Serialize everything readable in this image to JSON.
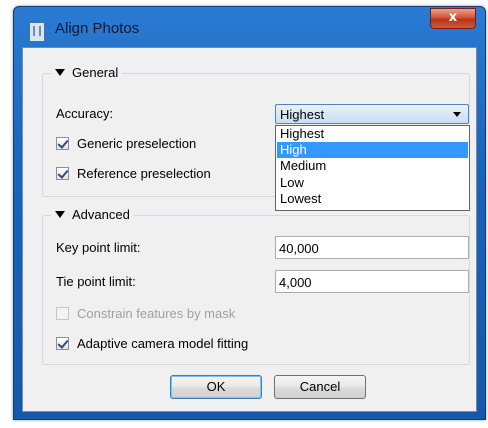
{
  "window": {
    "title": "Align Photos",
    "close_glyph": "x",
    "icon": "film-strip-icon"
  },
  "general": {
    "legend": "General",
    "accuracy_label": "Accuracy:",
    "accuracy_value": "Highest",
    "accuracy_options": [
      "Highest",
      "High",
      "Medium",
      "Low",
      "Lowest"
    ],
    "highlighted_option": "High",
    "generic_preselection_label": "Generic preselection",
    "generic_preselection_checked": true,
    "reference_preselection_label": "Reference preselection",
    "reference_preselection_checked": true
  },
  "advanced": {
    "legend": "Advanced",
    "key_point_limit_label": "Key point limit:",
    "key_point_limit_value": "40,000",
    "tie_point_limit_label": "Tie point limit:",
    "tie_point_limit_value": "4,000",
    "constrain_mask_label": "Constrain features by mask",
    "constrain_mask_checked": false,
    "constrain_mask_enabled": false,
    "adaptive_fitting_label": "Adaptive camera model fitting",
    "adaptive_fitting_checked": true
  },
  "buttons": {
    "ok_label": "OK",
    "cancel_label": "Cancel"
  },
  "colors": {
    "titlebar": "#1a63bb",
    "selection": "#3399ff",
    "close_button": "#c94428"
  }
}
